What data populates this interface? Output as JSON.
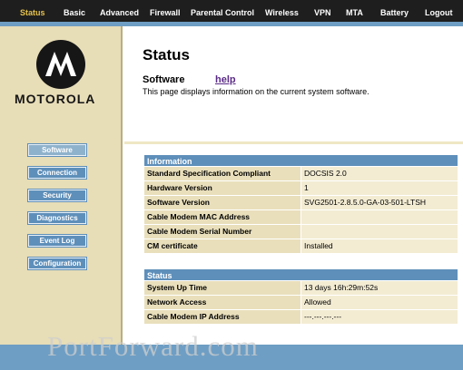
{
  "nav": [
    {
      "label": "Status",
      "active": true
    },
    {
      "label": "Basic"
    },
    {
      "label": "Advanced"
    },
    {
      "label": "Firewall"
    },
    {
      "label": "Parental Control"
    },
    {
      "label": "Wireless"
    },
    {
      "label": "VPN"
    },
    {
      "label": "MTA"
    },
    {
      "label": "Battery"
    },
    {
      "label": "Logout"
    }
  ],
  "brand": {
    "name": "MOTOROLA",
    "logo_icon": "motorola-batwing-logo"
  },
  "sidebar": {
    "items": [
      {
        "label": "Software",
        "active": true
      },
      {
        "label": "Connection"
      },
      {
        "label": "Security"
      },
      {
        "label": "Diagnostics"
      },
      {
        "label": "Event Log"
      },
      {
        "label": "Configuration"
      }
    ]
  },
  "page": {
    "title": "Status",
    "subtitle": "Software",
    "help_label": "help",
    "description": "This page displays information on the current system software."
  },
  "information": {
    "header": "Information",
    "rows": [
      {
        "key": "Standard Specification Compliant",
        "value": "DOCSIS 2.0"
      },
      {
        "key": "Hardware Version",
        "value": "1"
      },
      {
        "key": "Software Version",
        "value": "SVG2501-2.8.5.0-GA-03-501-LTSH"
      },
      {
        "key": "Cable Modem MAC Address",
        "value": ""
      },
      {
        "key": "Cable Modem Serial Number",
        "value": ""
      },
      {
        "key": "CM certificate",
        "value": "Installed"
      }
    ]
  },
  "status": {
    "header": "Status",
    "rows": [
      {
        "key": "System Up Time",
        "value": "13 days 16h:29m:52s"
      },
      {
        "key": "Network Access",
        "value": "Allowed"
      },
      {
        "key": "Cable Modem IP Address",
        "value": "---.---.---.---"
      }
    ]
  },
  "watermark": "PortForward.com",
  "colors": {
    "nav_bg": "#1e1e1e",
    "nav_active": "#e6c24a",
    "accent_blue": "#5e8fba",
    "sidebar_bg": "#e7ddb7",
    "table_key_bg": "#e9dfbb",
    "table_value_bg": "#f3ecd3",
    "help_link": "#5a2b86"
  }
}
